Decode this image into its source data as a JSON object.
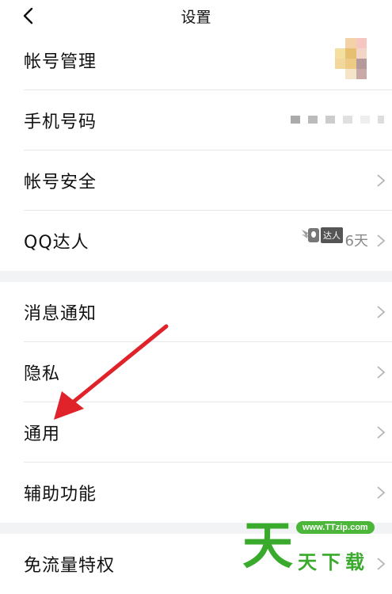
{
  "header": {
    "title": "设置",
    "back_icon": "chevron-left-icon"
  },
  "section1": {
    "items": [
      {
        "label": "帐号管理",
        "trailing": "avatar"
      },
      {
        "label": "手机号码",
        "trailing": "masked-number"
      },
      {
        "label": "帐号安全",
        "trailing": "chevron"
      },
      {
        "label": "QQ达人",
        "badge": "达人",
        "days": "6天",
        "trailing": "chevron"
      }
    ]
  },
  "section2": {
    "items": [
      {
        "label": "消息通知"
      },
      {
        "label": "隐私"
      },
      {
        "label": "通用"
      },
      {
        "label": "辅助功能"
      }
    ]
  },
  "section3": {
    "items": [
      {
        "label": "免流量特权"
      }
    ]
  },
  "watermark": {
    "url": "www.TTzip.com",
    "big": "天",
    "small": "天下载"
  },
  "colors": {
    "accent_arrow": "#e0222a",
    "watermark_green": "#3aaa2c",
    "separator": "#e8e8ea"
  }
}
